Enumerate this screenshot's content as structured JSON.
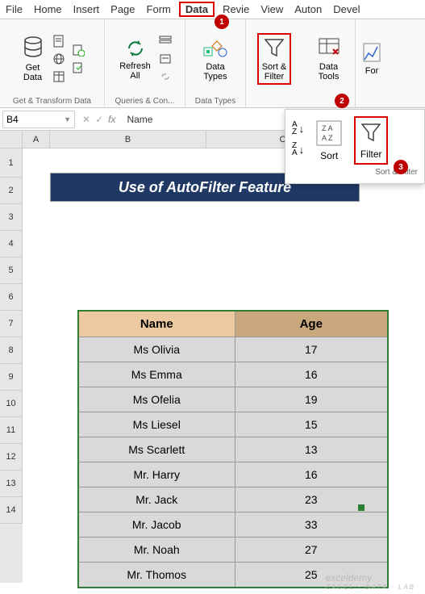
{
  "menubar": [
    "File",
    "Home",
    "Insert",
    "Page",
    "Form",
    "Data",
    "Revie",
    "View",
    "Auton",
    "Devel"
  ],
  "menubar_active_index": 5,
  "ribbon": {
    "get_transform": {
      "main": "Get\nData",
      "label": "Get & Transform Data"
    },
    "queries": {
      "main": "Refresh\nAll",
      "label": "Queries & Con..."
    },
    "data_types": {
      "main": "Data\nTypes",
      "label": "Data Types"
    },
    "sort_filter": {
      "main": "Sort &\nFilter"
    },
    "data_tools": {
      "main": "Data\nTools"
    },
    "forecast": {
      "main": "For"
    }
  },
  "namebox": "B4",
  "formula_value": "Name",
  "title_cell": "Use of AutoFilter Feature",
  "columns": [
    "A",
    "B",
    "C"
  ],
  "rows": [
    "1",
    "2",
    "3",
    "4",
    "5",
    "6",
    "7",
    "8",
    "9",
    "10",
    "11",
    "12",
    "13",
    "14"
  ],
  "table": {
    "headers": [
      "Name",
      "Age"
    ],
    "data": [
      [
        "Ms Olivia",
        "17"
      ],
      [
        "Ms Emma",
        "16"
      ],
      [
        "Ms Ofelia",
        "19"
      ],
      [
        "Ms Liesel",
        "15"
      ],
      [
        "Ms Scarlett",
        "13"
      ],
      [
        "Mr. Harry",
        "16"
      ],
      [
        "Mr. Jack",
        "23"
      ],
      [
        "Mr. Jacob",
        "33"
      ],
      [
        "Mr. Noah",
        "27"
      ],
      [
        "Mr. Thomos",
        "25"
      ]
    ]
  },
  "dropdown": {
    "sort": "Sort",
    "filter": "Filter",
    "label": "Sort & Filter"
  },
  "callouts": [
    "1",
    "2",
    "3"
  ],
  "watermark": {
    "main": "exceldemy",
    "sub": "EXCEL · DATA · LAB"
  }
}
